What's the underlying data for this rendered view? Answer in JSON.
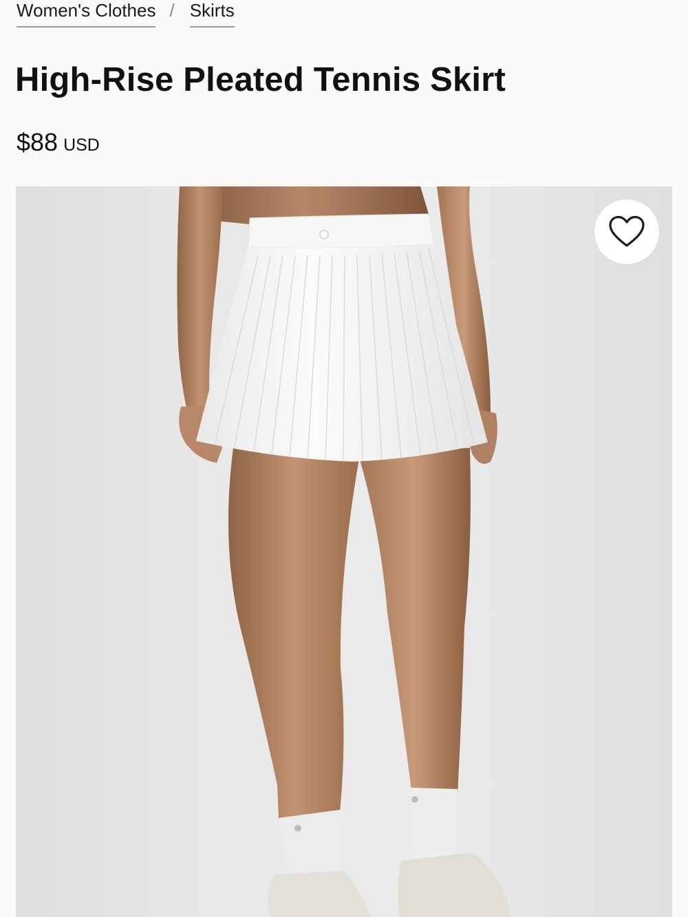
{
  "breadcrumb": {
    "items": [
      {
        "label": "Women's Clothes"
      },
      {
        "label": "Skirts"
      }
    ],
    "separator": "/"
  },
  "product": {
    "title": "High-Rise Pleated Tennis Skirt",
    "price": "$88",
    "currency": "USD"
  },
  "gallery": {
    "image_subject": "white pleated tennis skirt, back view",
    "wishlist_icon": "heart-outline-icon"
  },
  "colors": {
    "text": "#111111",
    "background": "#fafafa",
    "gallery_bg": "#e6e6e6",
    "skirt": "#f8f8f8"
  }
}
